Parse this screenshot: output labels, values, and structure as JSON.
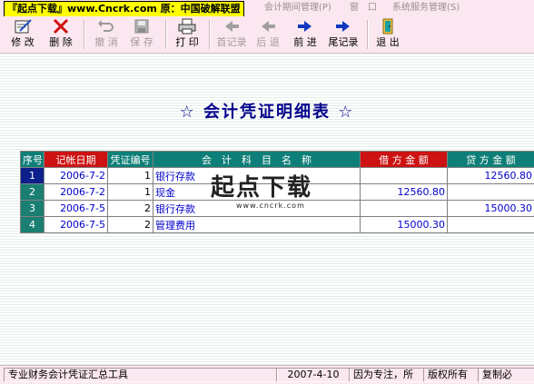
{
  "banner": "『起点下载』www.Cncrk.com 原：中国破解联盟",
  "menu": [
    {
      "label": "会计期间管理(P)"
    },
    {
      "label": "窗　口"
    },
    {
      "label": "系统服务管理(S)"
    }
  ],
  "toolbar": {
    "modify": "修 改",
    "delete": "删 除",
    "undo": "撤 消",
    "save": "保 存",
    "print": "打 印",
    "first": "首记录",
    "prev": "后 退",
    "next": "前 进",
    "last": "尾记录",
    "exit": "退 出"
  },
  "report": {
    "title": "☆ 会计凭证明细表 ☆"
  },
  "table": {
    "headers": {
      "seq": "序号",
      "date": "记帐日期",
      "voucher": "凭证编号",
      "account": "会　计　科　目　名　称",
      "debit": "借 方 金 额",
      "credit": "贷 方 金 额"
    },
    "rows": [
      {
        "seq": "1",
        "date": "2006-7-2",
        "voucher": "1",
        "account": "银行存款",
        "debit": "",
        "credit": "12560.80"
      },
      {
        "seq": "2",
        "date": "2006-7-2",
        "voucher": "1",
        "account": "现金",
        "debit": "12560.80",
        "credit": ""
      },
      {
        "seq": "3",
        "date": "2006-7-5",
        "voucher": "2",
        "account": "银行存款",
        "debit": "",
        "credit": "15000.30"
      },
      {
        "seq": "4",
        "date": "2006-7-5",
        "voucher": "2",
        "account": "管理费用",
        "debit": "15000.30",
        "credit": ""
      }
    ]
  },
  "watermark": {
    "text": "起点下载",
    "url": "www.cncrk.com"
  },
  "status": {
    "app": "专业财务会计凭证汇总工具",
    "date": "2007-4-10",
    "note": "因为专注，所",
    "rights": "版权所有",
    "copy": "复制必"
  }
}
